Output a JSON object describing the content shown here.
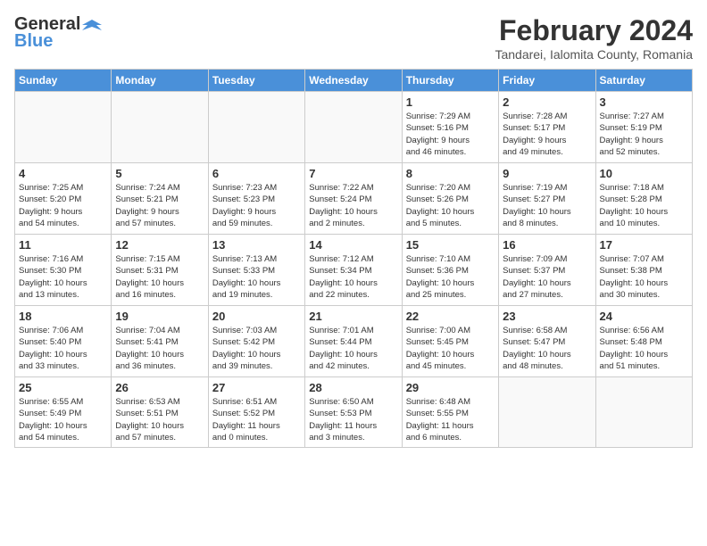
{
  "header": {
    "logo_general": "General",
    "logo_blue": "Blue",
    "month_title": "February 2024",
    "location": "Tandarei, Ialomita County, Romania"
  },
  "days_of_week": [
    "Sunday",
    "Monday",
    "Tuesday",
    "Wednesday",
    "Thursday",
    "Friday",
    "Saturday"
  ],
  "weeks": [
    [
      {
        "day": "",
        "info": ""
      },
      {
        "day": "",
        "info": ""
      },
      {
        "day": "",
        "info": ""
      },
      {
        "day": "",
        "info": ""
      },
      {
        "day": "1",
        "info": "Sunrise: 7:29 AM\nSunset: 5:16 PM\nDaylight: 9 hours\nand 46 minutes."
      },
      {
        "day": "2",
        "info": "Sunrise: 7:28 AM\nSunset: 5:17 PM\nDaylight: 9 hours\nand 49 minutes."
      },
      {
        "day": "3",
        "info": "Sunrise: 7:27 AM\nSunset: 5:19 PM\nDaylight: 9 hours\nand 52 minutes."
      }
    ],
    [
      {
        "day": "4",
        "info": "Sunrise: 7:25 AM\nSunset: 5:20 PM\nDaylight: 9 hours\nand 54 minutes."
      },
      {
        "day": "5",
        "info": "Sunrise: 7:24 AM\nSunset: 5:21 PM\nDaylight: 9 hours\nand 57 minutes."
      },
      {
        "day": "6",
        "info": "Sunrise: 7:23 AM\nSunset: 5:23 PM\nDaylight: 9 hours\nand 59 minutes."
      },
      {
        "day": "7",
        "info": "Sunrise: 7:22 AM\nSunset: 5:24 PM\nDaylight: 10 hours\nand 2 minutes."
      },
      {
        "day": "8",
        "info": "Sunrise: 7:20 AM\nSunset: 5:26 PM\nDaylight: 10 hours\nand 5 minutes."
      },
      {
        "day": "9",
        "info": "Sunrise: 7:19 AM\nSunset: 5:27 PM\nDaylight: 10 hours\nand 8 minutes."
      },
      {
        "day": "10",
        "info": "Sunrise: 7:18 AM\nSunset: 5:28 PM\nDaylight: 10 hours\nand 10 minutes."
      }
    ],
    [
      {
        "day": "11",
        "info": "Sunrise: 7:16 AM\nSunset: 5:30 PM\nDaylight: 10 hours\nand 13 minutes."
      },
      {
        "day": "12",
        "info": "Sunrise: 7:15 AM\nSunset: 5:31 PM\nDaylight: 10 hours\nand 16 minutes."
      },
      {
        "day": "13",
        "info": "Sunrise: 7:13 AM\nSunset: 5:33 PM\nDaylight: 10 hours\nand 19 minutes."
      },
      {
        "day": "14",
        "info": "Sunrise: 7:12 AM\nSunset: 5:34 PM\nDaylight: 10 hours\nand 22 minutes."
      },
      {
        "day": "15",
        "info": "Sunrise: 7:10 AM\nSunset: 5:36 PM\nDaylight: 10 hours\nand 25 minutes."
      },
      {
        "day": "16",
        "info": "Sunrise: 7:09 AM\nSunset: 5:37 PM\nDaylight: 10 hours\nand 27 minutes."
      },
      {
        "day": "17",
        "info": "Sunrise: 7:07 AM\nSunset: 5:38 PM\nDaylight: 10 hours\nand 30 minutes."
      }
    ],
    [
      {
        "day": "18",
        "info": "Sunrise: 7:06 AM\nSunset: 5:40 PM\nDaylight: 10 hours\nand 33 minutes."
      },
      {
        "day": "19",
        "info": "Sunrise: 7:04 AM\nSunset: 5:41 PM\nDaylight: 10 hours\nand 36 minutes."
      },
      {
        "day": "20",
        "info": "Sunrise: 7:03 AM\nSunset: 5:42 PM\nDaylight: 10 hours\nand 39 minutes."
      },
      {
        "day": "21",
        "info": "Sunrise: 7:01 AM\nSunset: 5:44 PM\nDaylight: 10 hours\nand 42 minutes."
      },
      {
        "day": "22",
        "info": "Sunrise: 7:00 AM\nSunset: 5:45 PM\nDaylight: 10 hours\nand 45 minutes."
      },
      {
        "day": "23",
        "info": "Sunrise: 6:58 AM\nSunset: 5:47 PM\nDaylight: 10 hours\nand 48 minutes."
      },
      {
        "day": "24",
        "info": "Sunrise: 6:56 AM\nSunset: 5:48 PM\nDaylight: 10 hours\nand 51 minutes."
      }
    ],
    [
      {
        "day": "25",
        "info": "Sunrise: 6:55 AM\nSunset: 5:49 PM\nDaylight: 10 hours\nand 54 minutes."
      },
      {
        "day": "26",
        "info": "Sunrise: 6:53 AM\nSunset: 5:51 PM\nDaylight: 10 hours\nand 57 minutes."
      },
      {
        "day": "27",
        "info": "Sunrise: 6:51 AM\nSunset: 5:52 PM\nDaylight: 11 hours\nand 0 minutes."
      },
      {
        "day": "28",
        "info": "Sunrise: 6:50 AM\nSunset: 5:53 PM\nDaylight: 11 hours\nand 3 minutes."
      },
      {
        "day": "29",
        "info": "Sunrise: 6:48 AM\nSunset: 5:55 PM\nDaylight: 11 hours\nand 6 minutes."
      },
      {
        "day": "",
        "info": ""
      },
      {
        "day": "",
        "info": ""
      }
    ]
  ]
}
